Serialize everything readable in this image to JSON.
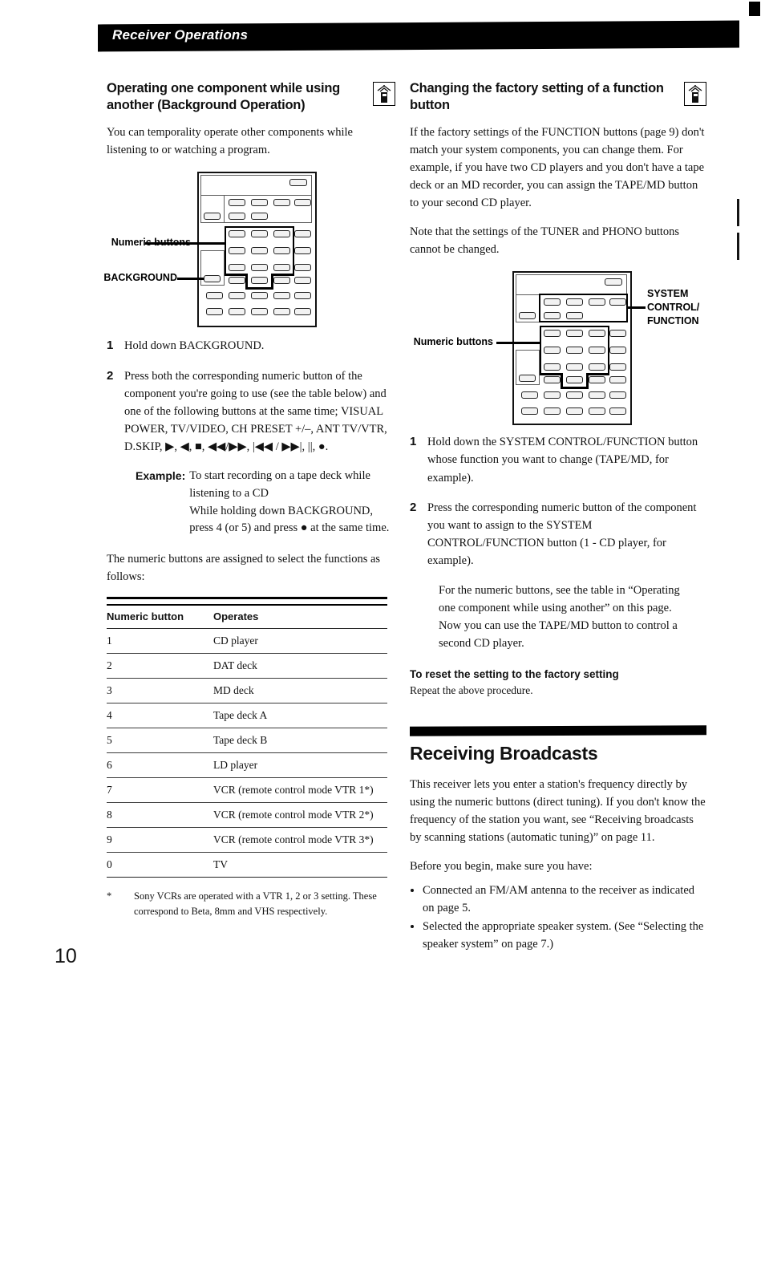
{
  "page": {
    "running_head": "Receiver Operations",
    "page_number": "10"
  },
  "left_column": {
    "heading": "Operating one component while using another (Background Operation)",
    "heading_icon": "remote-control-icon",
    "intro": "You can temporality operate other components while listening to or watching a program.",
    "figure": {
      "name": "remote-control-diagram",
      "callouts": [
        {
          "label": "Numeric buttons",
          "target": "numeric-buttons-group"
        },
        {
          "label": "BACKGROUND",
          "target": "background-button"
        }
      ]
    },
    "steps": [
      {
        "num": "1",
        "text": "Hold down BACKGROUND."
      },
      {
        "num": "2",
        "text": "Press both the corresponding numeric button of the component you're going to use (see the table below) and one of the following buttons at the same time; VISUAL POWER, TV/VIDEO, CH PRESET +/–, ANT TV/VTR, D.SKIP, ▶, ◀, ■, ◀◀/▶▶, |◀◀ / ▶▶|, ||, ●."
      }
    ],
    "example": {
      "label": "Example:",
      "text": "To start recording on a tape deck while listening to a CD\nWhile holding down BACKGROUND, press 4 (or 5)  and press ● at the same time."
    },
    "table_intro": "The numeric buttons are assigned to select the functions as follows:",
    "table": {
      "headers": [
        "Numeric button",
        "Operates"
      ],
      "rows": [
        [
          "1",
          "CD player"
        ],
        [
          "2",
          "DAT deck"
        ],
        [
          "3",
          "MD deck"
        ],
        [
          "4",
          "Tape deck A"
        ],
        [
          "5",
          "Tape deck B"
        ],
        [
          "6",
          "LD player"
        ],
        [
          "7",
          "VCR (remote control mode VTR 1*)"
        ],
        [
          "8",
          "VCR (remote control mode VTR 2*)"
        ],
        [
          "9",
          "VCR (remote control mode VTR 3*)"
        ],
        [
          "0",
          "TV"
        ]
      ]
    },
    "footnote": {
      "marker": "*",
      "text": "Sony VCRs are operated with a VTR 1, 2 or 3 setting. These correspond to Beta, 8mm and VHS respectively."
    }
  },
  "right_column": {
    "heading": "Changing the factory setting of a function button",
    "heading_icon": "remote-control-icon",
    "paragraph_1": "If the factory settings of the FUNCTION buttons (page 9) don't match your system components, you can change them. For example, if you have two CD players and you don't have a tape deck or an MD recorder, you can assign the TAPE/MD button to your second CD player.",
    "paragraph_2": "Note that the settings of the TUNER and PHONO buttons cannot be changed.",
    "figure": {
      "name": "remote-control-diagram",
      "callouts": [
        {
          "label": "SYSTEM CONTROL/ FUNCTION",
          "target": "system-control-function-group"
        },
        {
          "label": "Numeric buttons",
          "target": "numeric-buttons-group"
        }
      ]
    },
    "steps": [
      {
        "num": "1",
        "text": "Hold down the SYSTEM CONTROL/FUNCTION button whose function you want to change (TAPE/MD, for example)."
      },
      {
        "num": "2",
        "text": "Press the corresponding numeric button of the component you want to assign to the SYSTEM CONTROL/FUNCTION button (1 - CD player, for example)."
      }
    ],
    "step_note": "For the numeric buttons, see the table in “Operating one component while using another” on this page. Now you can use the TAPE/MD button to control a second CD player.",
    "reset_subhead": "To reset the setting to the factory setting",
    "reset_body": "Repeat the above procedure.",
    "chapter": {
      "title": "Receiving Broadcasts",
      "paragraph": "This receiver lets you enter a station's frequency directly by using the numeric buttons (direct tuning). If you don't know the frequency of the station you want, see “Receiving broadcasts by scanning stations (automatic tuning)” on page 11.",
      "before_intro": "Before you begin, make sure you have:",
      "bullets": [
        "Connected an FM/AM antenna to the receiver as indicated on page 5.",
        "Selected the appropriate speaker system. (See “Selecting the speaker system” on page 7.)"
      ]
    }
  },
  "colors": {
    "ink": "#111111",
    "banner": "#000000",
    "paper": "#ffffff"
  }
}
